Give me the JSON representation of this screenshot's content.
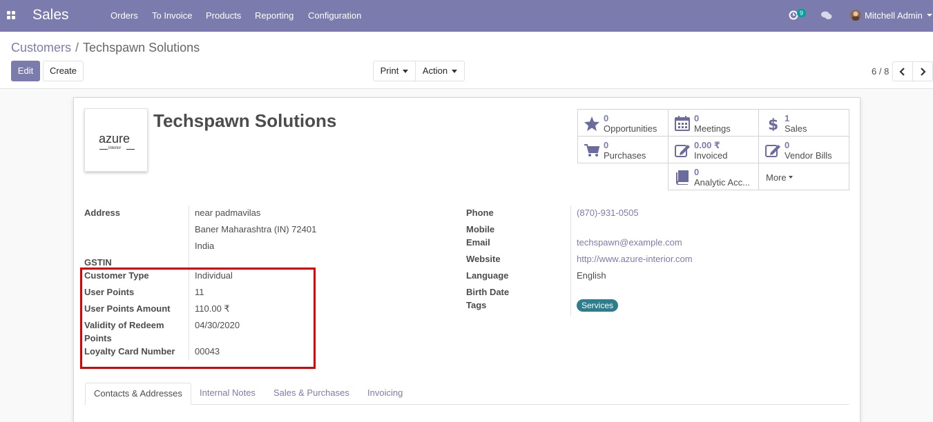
{
  "navbar": {
    "app_title": "Sales",
    "menu": [
      "Orders",
      "To Invoice",
      "Products",
      "Reporting",
      "Configuration"
    ],
    "activity_count": "9",
    "user_name": "Mitchell Admin"
  },
  "control_panel": {
    "breadcrumb_parent": "Customers",
    "breadcrumb_separator": "/",
    "breadcrumb_current": "Techspawn Solutions",
    "edit_label": "Edit",
    "create_label": "Create",
    "print_label": "Print",
    "action_label": "Action",
    "pager_value": "6 / 8"
  },
  "partner": {
    "name": "Techspawn Solutions",
    "logo_text": "azure",
    "logo_subtext": "interior"
  },
  "smart_buttons": [
    {
      "value": "0",
      "label": "Opportunities",
      "icon": "star-icon"
    },
    {
      "value": "0",
      "label": "Meetings",
      "icon": "calendar-icon"
    },
    {
      "value": "1",
      "label": "Sales",
      "icon": "dollar-icon"
    },
    {
      "value": "0",
      "label": "Purchases",
      "icon": "cart-icon"
    },
    {
      "value": "0.00 ₹",
      "label": "Invoiced",
      "icon": "pencil-square-icon"
    },
    {
      "value": "0",
      "label": "Vendor Bills",
      "icon": "pencil-square-icon"
    },
    {
      "value": "0",
      "label": "Analytic Acc...",
      "icon": "book-icon"
    }
  ],
  "more_label": "More",
  "left_fields": {
    "address_label": "Address",
    "address_line1": "near padmavilas",
    "address_line2": "Baner  Maharashtra (IN)  72401",
    "address_line3": "India",
    "gstin_label": "GSTIN",
    "customer_type_label": "Customer Type",
    "customer_type_value": "Individual",
    "user_points_label": "User Points",
    "user_points_value": "11",
    "user_points_amount_label": "User Points Amount",
    "user_points_amount_value": "110.00 ₹",
    "validity_label_1": "Validity of Redeem",
    "validity_label_2": "Points",
    "validity_value": "04/30/2020",
    "loyalty_label": "Loyalty Card Number",
    "loyalty_value": "00043"
  },
  "right_fields": {
    "phone_label": "Phone",
    "phone_value": "(870)-931-0505",
    "mobile_label": "Mobile",
    "email_label": "Email",
    "email_value": "techspawn@example.com",
    "website_label": "Website",
    "website_value": "http://www.azure-interior.com",
    "language_label": "Language",
    "language_value": "English",
    "birth_date_label": "Birth Date",
    "tags_label": "Tags",
    "tag_value": "Services"
  },
  "tabs": [
    "Contacts & Addresses",
    "Internal Notes",
    "Sales & Purchases",
    "Invoicing"
  ],
  "colors": {
    "brand": "#7c7bad",
    "highlight": "#e00000",
    "tag": "#2e7d8c"
  }
}
